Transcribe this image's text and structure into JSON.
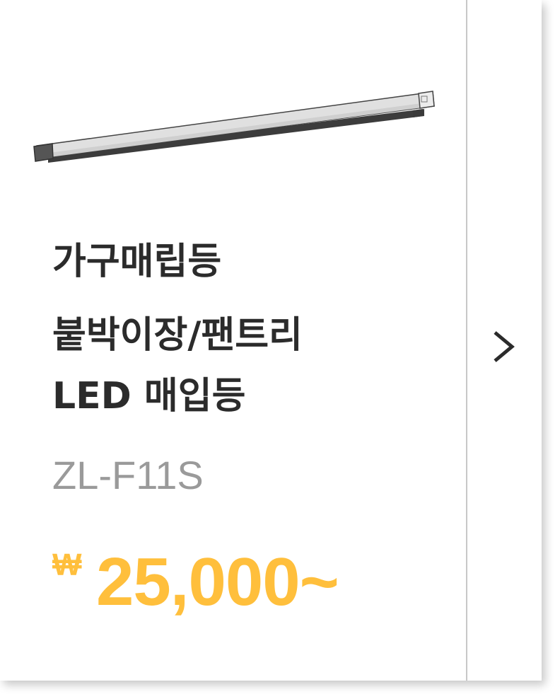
{
  "product": {
    "title_lines": [
      "가구매립등",
      "붙박이장/팬트리",
      "LED 매입등"
    ],
    "model": "ZL-F11S",
    "currency_symbol": "₩",
    "price": "25,000~",
    "image_icon": "led-bar-light-icon"
  },
  "navigation": {
    "next_icon": "chevron-right-icon"
  },
  "colors": {
    "title": "#2b2b2b",
    "model": "#9a9a9a",
    "price": "#ffbf3c",
    "divider": "#c8c8c8"
  }
}
